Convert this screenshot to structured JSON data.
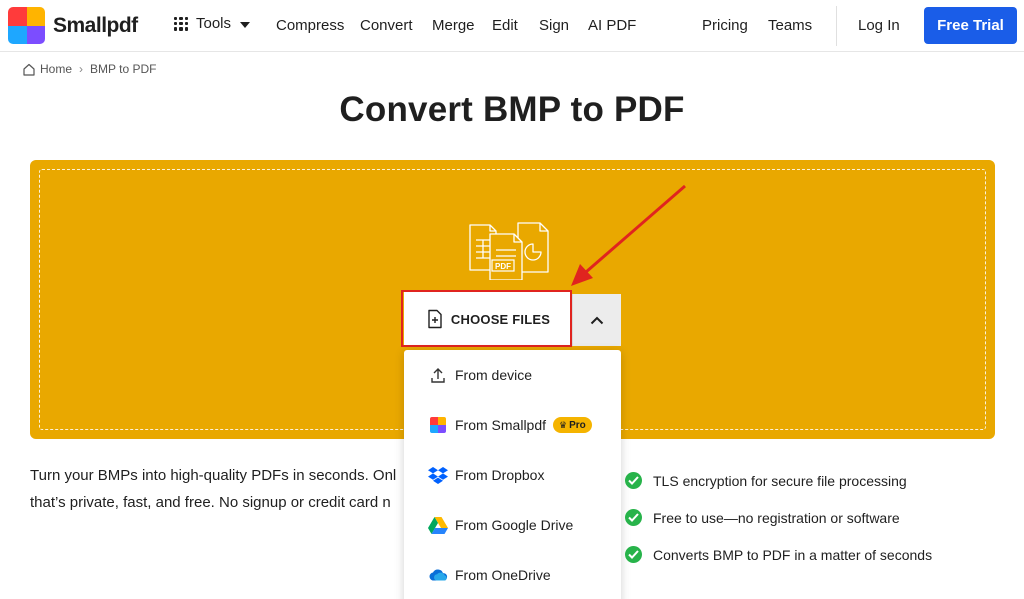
{
  "header": {
    "brand": "Smallpdf",
    "tools_label": "Tools",
    "nav": [
      "Compress",
      "Convert",
      "Merge",
      "Edit",
      "Sign",
      "AI PDF"
    ],
    "pricing": "Pricing",
    "teams": "Teams",
    "login": "Log In",
    "cta": "Free Trial",
    "cta_color": "#1a5de8"
  },
  "breadcrumb": {
    "home": "Home",
    "current": "BMP to PDF"
  },
  "page_title": "Convert BMP to PDF",
  "dropzone": {
    "color": "#e9a800",
    "illustration_badge": "PDF",
    "choose_files": "CHOOSE FILES"
  },
  "menu": {
    "items": [
      {
        "label": "From device",
        "icon": "upload-icon"
      },
      {
        "label": "From Smallpdf",
        "icon": "smallpdf-logo-icon",
        "badge": "Pro"
      },
      {
        "label": "From Dropbox",
        "icon": "dropbox-icon"
      },
      {
        "label": "From Google Drive",
        "icon": "google-drive-icon"
      },
      {
        "label": "From OneDrive",
        "icon": "onedrive-icon"
      }
    ]
  },
  "description": {
    "line1": "Turn your BMPs into high-quality PDFs in seconds. Onl",
    "line2": "that’s private, fast, and free. No signup or credit card n"
  },
  "features": [
    "TLS encryption for secure file processing",
    "Free to use—no registration or software",
    "Converts BMP to PDF in a matter of seconds"
  ],
  "annotation": {
    "highlight_color": "#e0241f"
  }
}
